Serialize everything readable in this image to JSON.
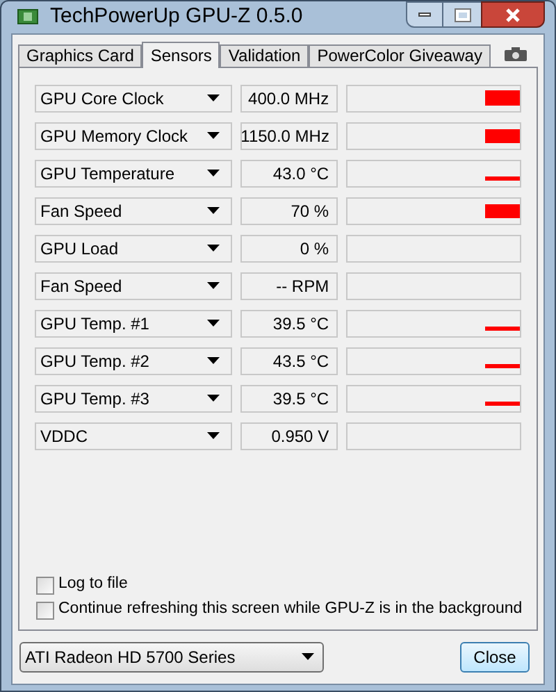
{
  "window": {
    "title": "TechPowerUp GPU-Z 0.5.0"
  },
  "tabs": [
    {
      "label": "Graphics Card",
      "selected": false
    },
    {
      "label": "Sensors",
      "selected": true
    },
    {
      "label": "Validation",
      "selected": false
    },
    {
      "label": "PowerColor Giveaway",
      "selected": false
    }
  ],
  "sensors": [
    {
      "name": "GPU Core Clock",
      "value": "400.0 MHz"
    },
    {
      "name": "GPU Memory Clock",
      "value": "1150.0 MHz"
    },
    {
      "name": "GPU Temperature",
      "value": "43.0 °C"
    },
    {
      "name": "Fan Speed",
      "value": "70 %"
    },
    {
      "name": "GPU Load",
      "value": "0 %"
    },
    {
      "name": "Fan Speed",
      "value": "-- RPM"
    },
    {
      "name": "GPU Temp. #1",
      "value": "39.5 °C"
    },
    {
      "name": "GPU Temp. #2",
      "value": "43.5 °C"
    },
    {
      "name": "GPU Temp. #3",
      "value": "39.5 °C"
    },
    {
      "name": "VDDC",
      "value": "0.950 V"
    }
  ],
  "options": [
    {
      "label": "Log to file",
      "checked": false
    },
    {
      "label": "Continue refreshing this screen while GPU-Z is in the background",
      "checked": false
    }
  ],
  "card_select": {
    "value": "ATI Radeon HD 5700 Series"
  },
  "close_button": {
    "label": "Close"
  }
}
